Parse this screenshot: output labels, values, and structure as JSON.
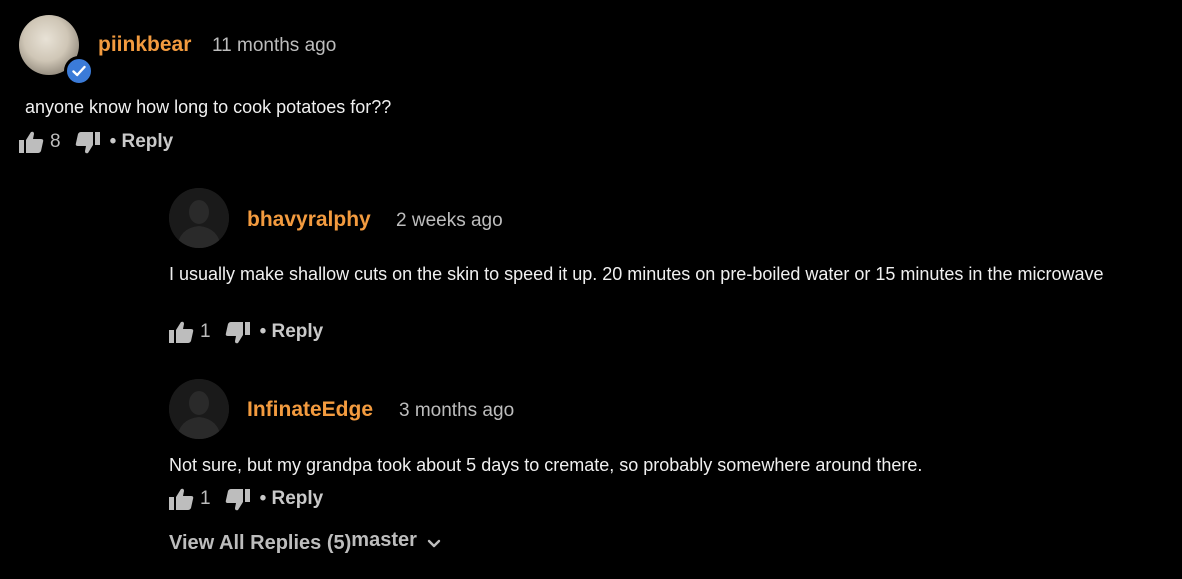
{
  "comments": [
    {
      "username": "piinkbear",
      "time": "11 months ago",
      "text": "anyone know how long to cook potatoes for??",
      "likes": "8",
      "reply_label": "• Reply",
      "avatar": "user-photo",
      "verified": true
    },
    {
      "username": "bhavyralphy",
      "time": "2 weeks ago",
      "text": " I usually make shallow cuts on the skin to speed it up. 20 minutes on pre-boiled water or 15 minutes in the microwave",
      "likes": "1",
      "reply_label": "• Reply",
      "avatar": "default-user-icon"
    },
    {
      "username": "InfinateEdge",
      "time": "3 months ago",
      "text": " Not sure, but my grandpa took about 5 days to cremate, so probably somewhere around there.",
      "likes": "1",
      "reply_label": "• Reply",
      "avatar": "default-user-icon"
    }
  ],
  "view_all": {
    "label": "View All Replies (5)",
    "suffix": "master"
  },
  "colors": {
    "background": "#000000",
    "username": "#f39b3f",
    "verified_badge": "#3b7bd8",
    "muted_text": "#bdbdbd"
  }
}
